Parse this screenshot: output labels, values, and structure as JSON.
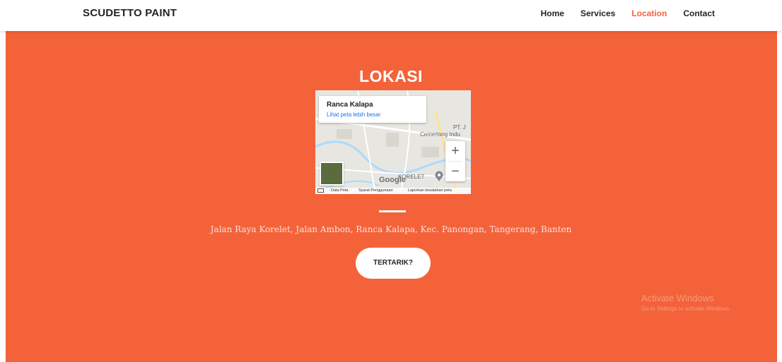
{
  "nav": {
    "brand": "SCUDETTO PAINT",
    "links": [
      {
        "label": "Home",
        "active": false
      },
      {
        "label": "Services",
        "active": false
      },
      {
        "label": "Location",
        "active": true
      },
      {
        "label": "Contact",
        "active": false
      }
    ]
  },
  "section": {
    "title": "LOKASI",
    "address": "Jalan Raya Korelet, Jalan Ambon, Ranca Kalapa, Kec. Panongan, Tangerang, Banten",
    "cta_label": "TERTARIK?",
    "background_color": "#f4623a",
    "accent_color": "#f4623a"
  },
  "map": {
    "place_name": "Ranca Kalapa",
    "larger_map_link": "Lihat peta lebih besar",
    "label_pt": "PT. J",
    "label_cemerlang": "Cemerlang Indu",
    "label_korelet": "KORELET",
    "google_logo": "Google",
    "zoom_in": "+",
    "zoom_out": "−",
    "footer": {
      "data": "Data Peta",
      "terms": "Syarat Penggunaan",
      "report": "Laporkan kesalahan peta"
    }
  },
  "watermark": {
    "title": "Activate Windows",
    "subtitle": "Go to Settings to activate Windows."
  }
}
